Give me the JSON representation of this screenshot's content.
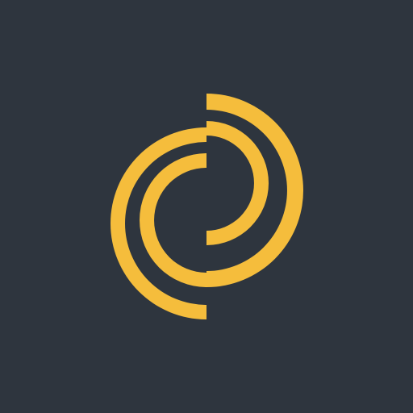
{
  "colors": {
    "background": "#2e353e",
    "accent": "#f5bd3c"
  },
  "logo": {
    "icon": "interlocking-arcs-logo-icon"
  }
}
